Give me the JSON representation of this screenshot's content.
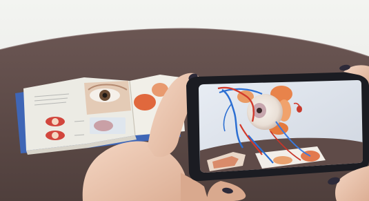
{
  "photo": {
    "subject": "ar-anatomy-book",
    "colors": {
      "wall": "#eef0ed",
      "table": "#5e4a47",
      "table_edge": "#4e3d3a",
      "book_page": "#ebe9e2",
      "book_cover": "#3f66b6",
      "phone_body": "#1b1c22",
      "skin": "#efcbb4",
      "skin_shadow": "#d6a88e",
      "nail": "#2d2a39",
      "eye_iris": "#6a4c35",
      "vein_blue": "#2c6fd2",
      "artery_red": "#d23a2c",
      "muscle_orange": "#e8834b",
      "ar_bg": "#dfe4ee"
    }
  }
}
